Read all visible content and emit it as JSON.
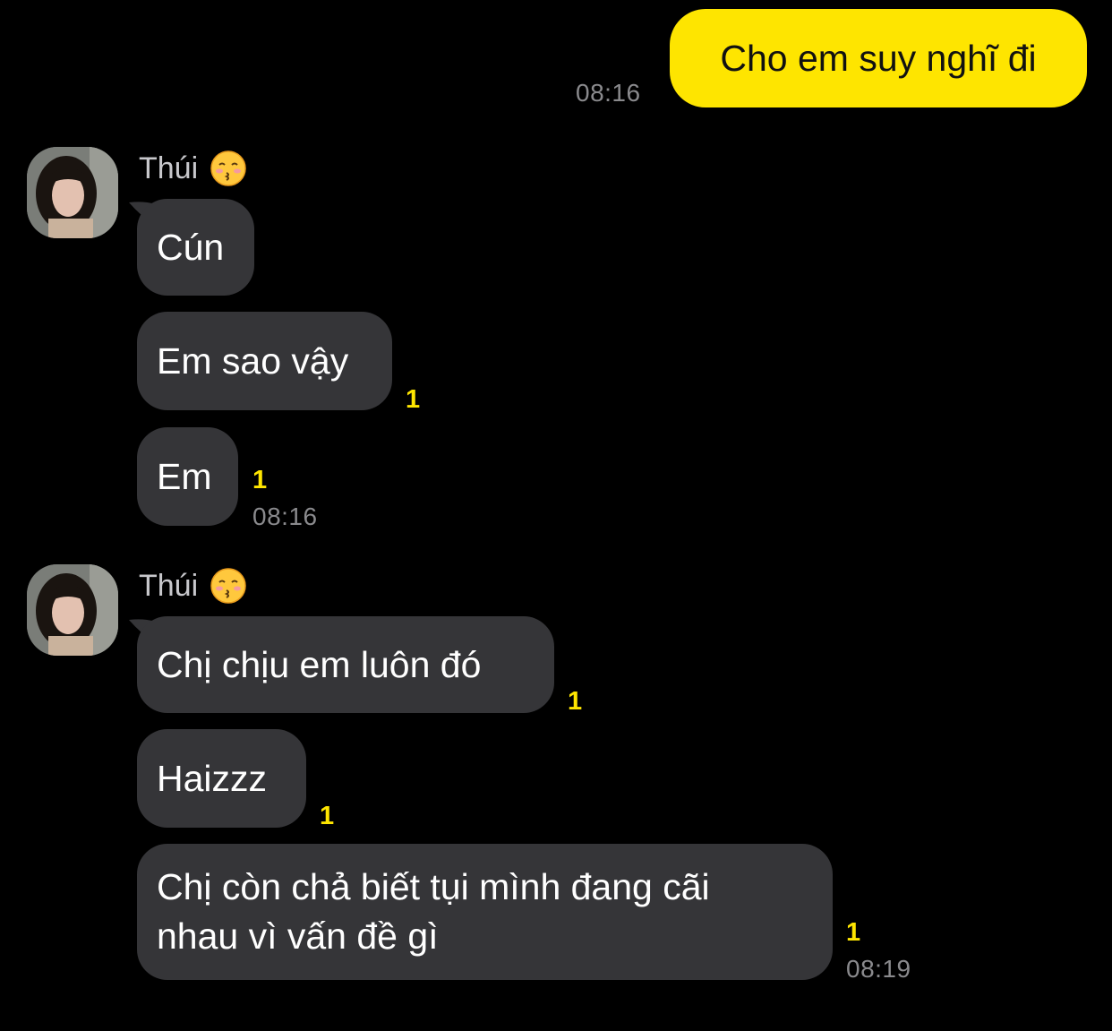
{
  "messages": {
    "outgoing_1": {
      "text": "Cho em suy nghĩ đi",
      "time": "08:16"
    },
    "group_1": {
      "sender": "Thúi",
      "emoji": "kissing-face-closed-eyes-icon",
      "bubbles": [
        {
          "text": "Cún",
          "unread": ""
        },
        {
          "text": "Em sao vậy",
          "unread": "1"
        },
        {
          "text": "Em",
          "unread": "1",
          "time": "08:16"
        }
      ]
    },
    "group_2": {
      "sender": "Thúi",
      "emoji": "kissing-face-closed-eyes-icon",
      "bubbles": [
        {
          "text": "Chị chịu em luôn đó",
          "unread": "1"
        },
        {
          "text": "Haizzz",
          "unread": "1"
        },
        {
          "line1": "Chị còn chả biết tụi mình đang cãi",
          "line2": "nhau vì vấn đề gì",
          "unread": "1",
          "time": "08:19"
        }
      ]
    }
  },
  "colors": {
    "outgoing_bubble": "#fee500",
    "incoming_bubble": "#353538",
    "background": "#000000",
    "unread": "#fee500",
    "time": "#8a8a8d"
  }
}
